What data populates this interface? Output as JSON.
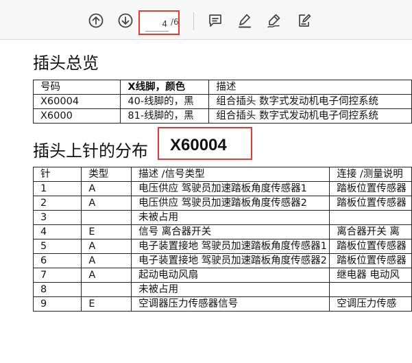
{
  "toolbar": {
    "current_page": "4",
    "page_total": "/6"
  },
  "section1": {
    "title": "插头总览",
    "headers": [
      "号码",
      "X线脚，颜色",
      "描述"
    ],
    "rows": [
      [
        "X60004",
        "40-线脚的，黑",
        "组合插头 数字式发动机电子伺控系统"
      ],
      [
        "X6000",
        "81-线脚的，黑",
        "组合插头 数字式发动机电子伺控系统"
      ]
    ]
  },
  "section2": {
    "title": "插头上针的分布",
    "code": "X60004",
    "headers": [
      "针",
      "类型",
      "描述 /信号类型",
      "连接 /测量说明"
    ],
    "rows": [
      [
        "1",
        "A",
        "电压供应 驾驶员加速踏板角度传感器1",
        "踏板位置传感器"
      ],
      [
        "2",
        "A",
        "电压供应 驾驶员加速踏板角度传感器2",
        "踏板位置传感器"
      ],
      [
        "3",
        "",
        "未被占用",
        ""
      ],
      [
        "4",
        "E",
        "信号 离合器开关",
        "离合器开关 离"
      ],
      [
        "5",
        "A",
        "电子装置接地 驾驶员加速踏板角度传感器1",
        "踏板位置传感器"
      ],
      [
        "6",
        "A",
        "电子装置接地 驾驶员加速踏板角度传感器2",
        "踏板位置传感器"
      ],
      [
        "7",
        "A",
        "起动电动风扇",
        "继电器 电动风"
      ],
      [
        "8",
        "",
        "未被占用",
        ""
      ],
      [
        "9",
        "E",
        "空调器压力传感器信号",
        "空调压力传感"
      ]
    ]
  }
}
